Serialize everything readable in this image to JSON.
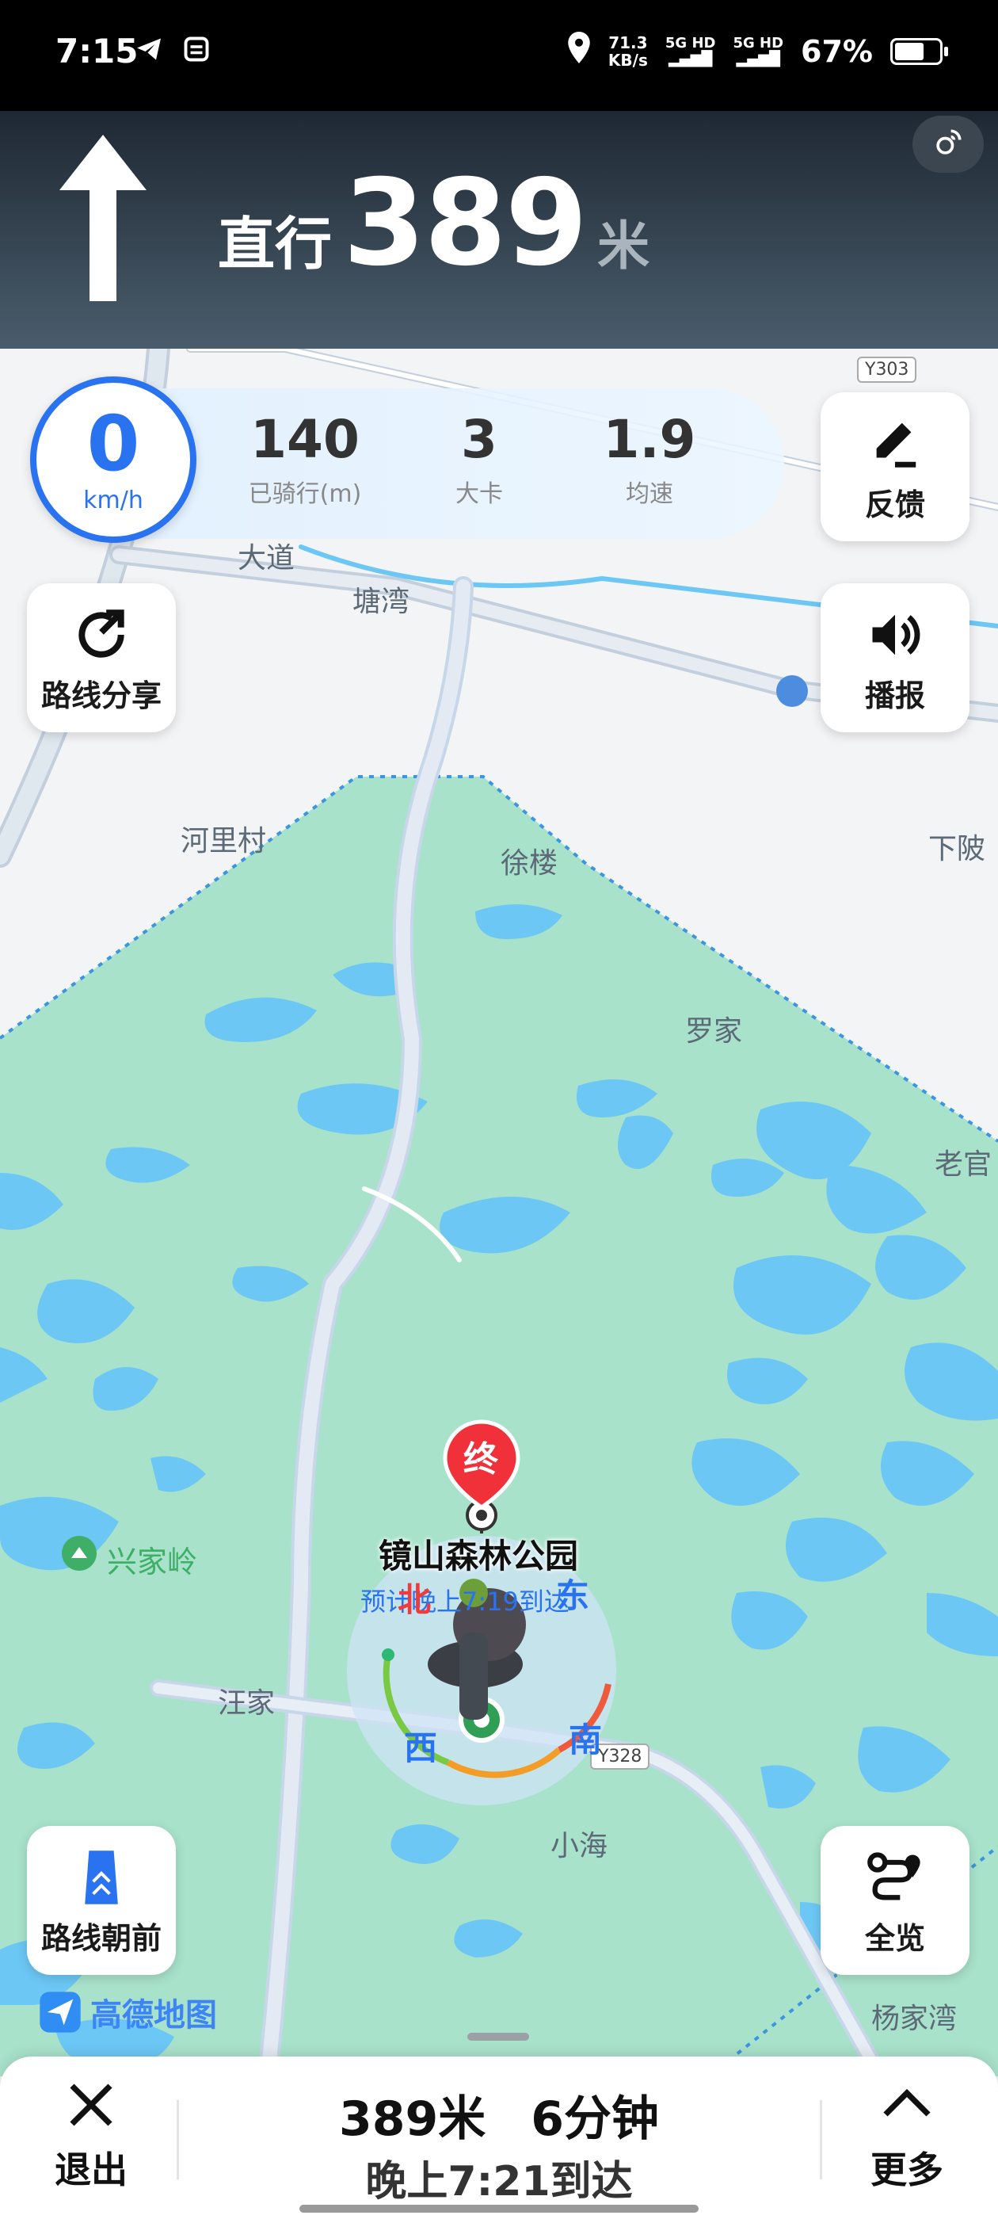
{
  "status_bar": {
    "time": "7:15",
    "net_speed_value": "71.3",
    "net_speed_unit": "KB/s",
    "sim1": "5G HD",
    "sim2": "5G HD",
    "battery": "67%",
    "battery_level": 0.67,
    "icons": [
      "telegram-icon",
      "calendar-icon",
      "location-icon",
      "signal-icon"
    ]
  },
  "navigation": {
    "direction_icon": "straight-arrow-icon",
    "action": "直行",
    "distance": "389",
    "unit": "米"
  },
  "ride_stats": {
    "speed": "0",
    "speed_unit": "km/h",
    "ridden_value": "140",
    "ridden_label": "已骑行(m)",
    "calories_value": "3",
    "calories_label": "大卡",
    "avg_value": "1.9",
    "avg_label": "均速"
  },
  "buttons": {
    "feedback": "反馈",
    "share_route": "路线分享",
    "broadcast": "播报",
    "route_forward": "路线朝前",
    "overview": "全览"
  },
  "map": {
    "labels": [
      "大道",
      "塘湾",
      "河里村",
      "徐楼",
      "下陂",
      "罗家",
      "老官",
      "兴家岭",
      "汪家",
      "小海",
      "杨家湾"
    ],
    "road_badges": [
      "Y303",
      "Y328"
    ],
    "destination_marker": "终",
    "destination_name": "镜山森林公园",
    "destination_sub": "预计晚上7:19到达",
    "compass": [
      "北",
      "东",
      "西",
      "南"
    ],
    "brand": "高德地图",
    "colors": {
      "park": "#a8e2cb",
      "water": "#6cc7f4",
      "road": "#ffffff",
      "accent": "#2a73f0",
      "dest": "#f0313a"
    }
  },
  "bottom_sheet": {
    "exit": "退出",
    "remaining_distance": "389米",
    "remaining_time": "6分钟",
    "arrival": "晚上7:21到达",
    "more": "更多"
  }
}
